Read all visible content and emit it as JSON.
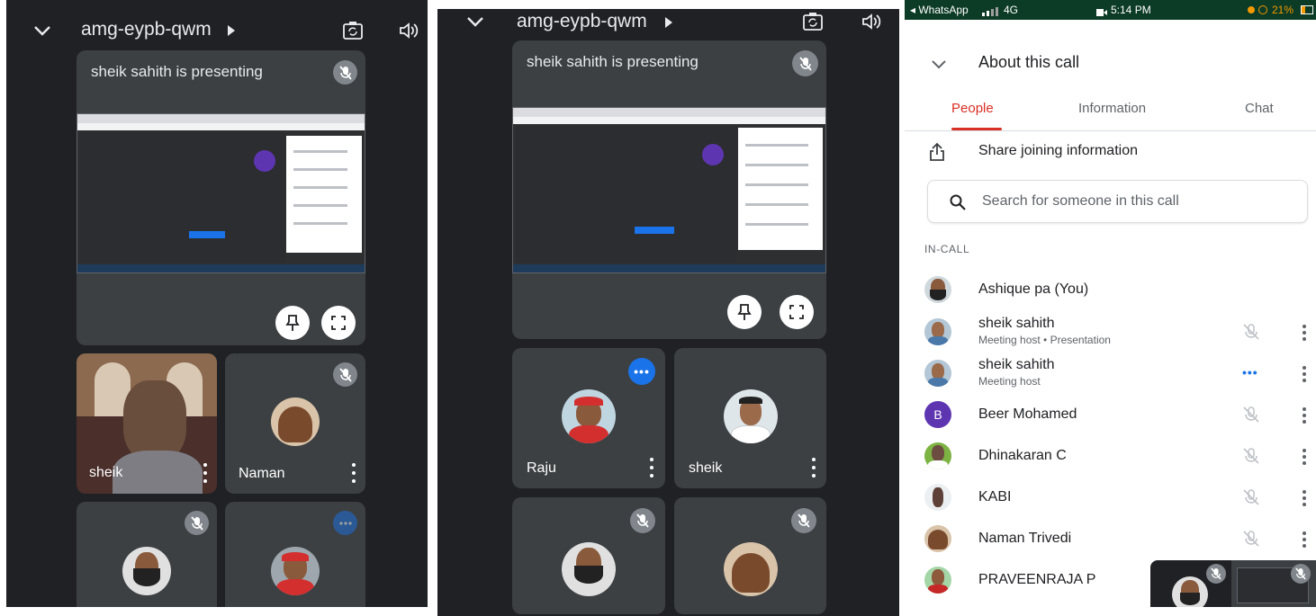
{
  "panel1": {
    "meeting_code": "amg-eypb-qwm",
    "presenting_text": "sheik sahith is presenting",
    "tiles": [
      {
        "name": "sheik"
      },
      {
        "name": "Naman"
      }
    ]
  },
  "panel2": {
    "meeting_code": "amg-eypb-qwm",
    "presenting_text": "sheik sahith is presenting",
    "tiles": [
      {
        "name": "Raju"
      },
      {
        "name": "sheik"
      }
    ]
  },
  "panel3": {
    "status": {
      "carrier": "◂ WhatsApp",
      "network": "4G",
      "time": "5:14 PM",
      "battery": "21%"
    },
    "header_title": "About this call",
    "tabs": [
      "People",
      "Information",
      "Chat"
    ],
    "share_label": "Share joining information",
    "search_placeholder": "Search for someone in this call",
    "section_label": "IN-CALL",
    "people": [
      {
        "name": "Ashique pa (You)",
        "sub": ""
      },
      {
        "name": "sheik sahith",
        "sub": "Meeting host • Presentation"
      },
      {
        "name": "sheik sahith",
        "sub": "Meeting host"
      },
      {
        "name": "Beer Mohamed",
        "sub": "",
        "initial": "B"
      },
      {
        "name": "Dhinakaran C",
        "sub": ""
      },
      {
        "name": "KABI",
        "sub": ""
      },
      {
        "name": "Naman Trivedi",
        "sub": ""
      },
      {
        "name": "PRAVEENRAJA P",
        "sub": ""
      }
    ]
  },
  "colors": {
    "accent_red": "#d93025",
    "accent_blue": "#1a73e8",
    "dark_bg": "#202124",
    "tile_bg": "#3c4043",
    "avatar_purple": "#5e35b1"
  }
}
